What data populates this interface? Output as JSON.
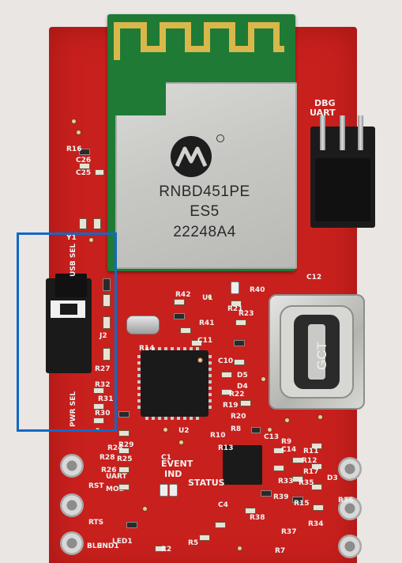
{
  "photo": {
    "module_marking": {
      "logo": "microchip-logo",
      "part": "RNBD451PE",
      "rev": "ES5",
      "lot": "22248A4"
    },
    "usb_connector_marking": "GCT",
    "silkscreen": {
      "dbg_uart_1": "DBG",
      "dbg_uart_2": "UART",
      "usb_sel": "USB SEL",
      "pwr_sel": "PWR SEL",
      "event_ind_1": "EVENT",
      "event_ind_2": "IND",
      "status": "STATUS",
      "rst_uart_1": "RST",
      "rst_uart_2": "UART",
      "rts": "RTS",
      "mod": "MOD",
      "ble_ind_1": "BLE",
      "ble_ind_2": "IND1",
      "refdes": [
        "R16",
        "C26",
        "C25",
        "Y1",
        "J2",
        "R42",
        "R41",
        "C11",
        "R14",
        "R21",
        "R40",
        "U1",
        "C12",
        "D5",
        "R19",
        "R22",
        "D4",
        "R20",
        "R10",
        "R13",
        "U2",
        "C1",
        "C13",
        "R9",
        "C14",
        "R11",
        "R12",
        "R17",
        "R33",
        "R35",
        "R15",
        "R34",
        "R39",
        "R38",
        "R24",
        "R27",
        "R32",
        "R31",
        "R30",
        "R29",
        "R28",
        "R26",
        "R25",
        "R2",
        "R5",
        "R7",
        "R8",
        "D3",
        "R36",
        "R37",
        "LED1",
        "C4",
        "C10",
        "R23"
      ]
    },
    "highlight_box_color": "#1468c4",
    "board_color": "#c8201d"
  }
}
